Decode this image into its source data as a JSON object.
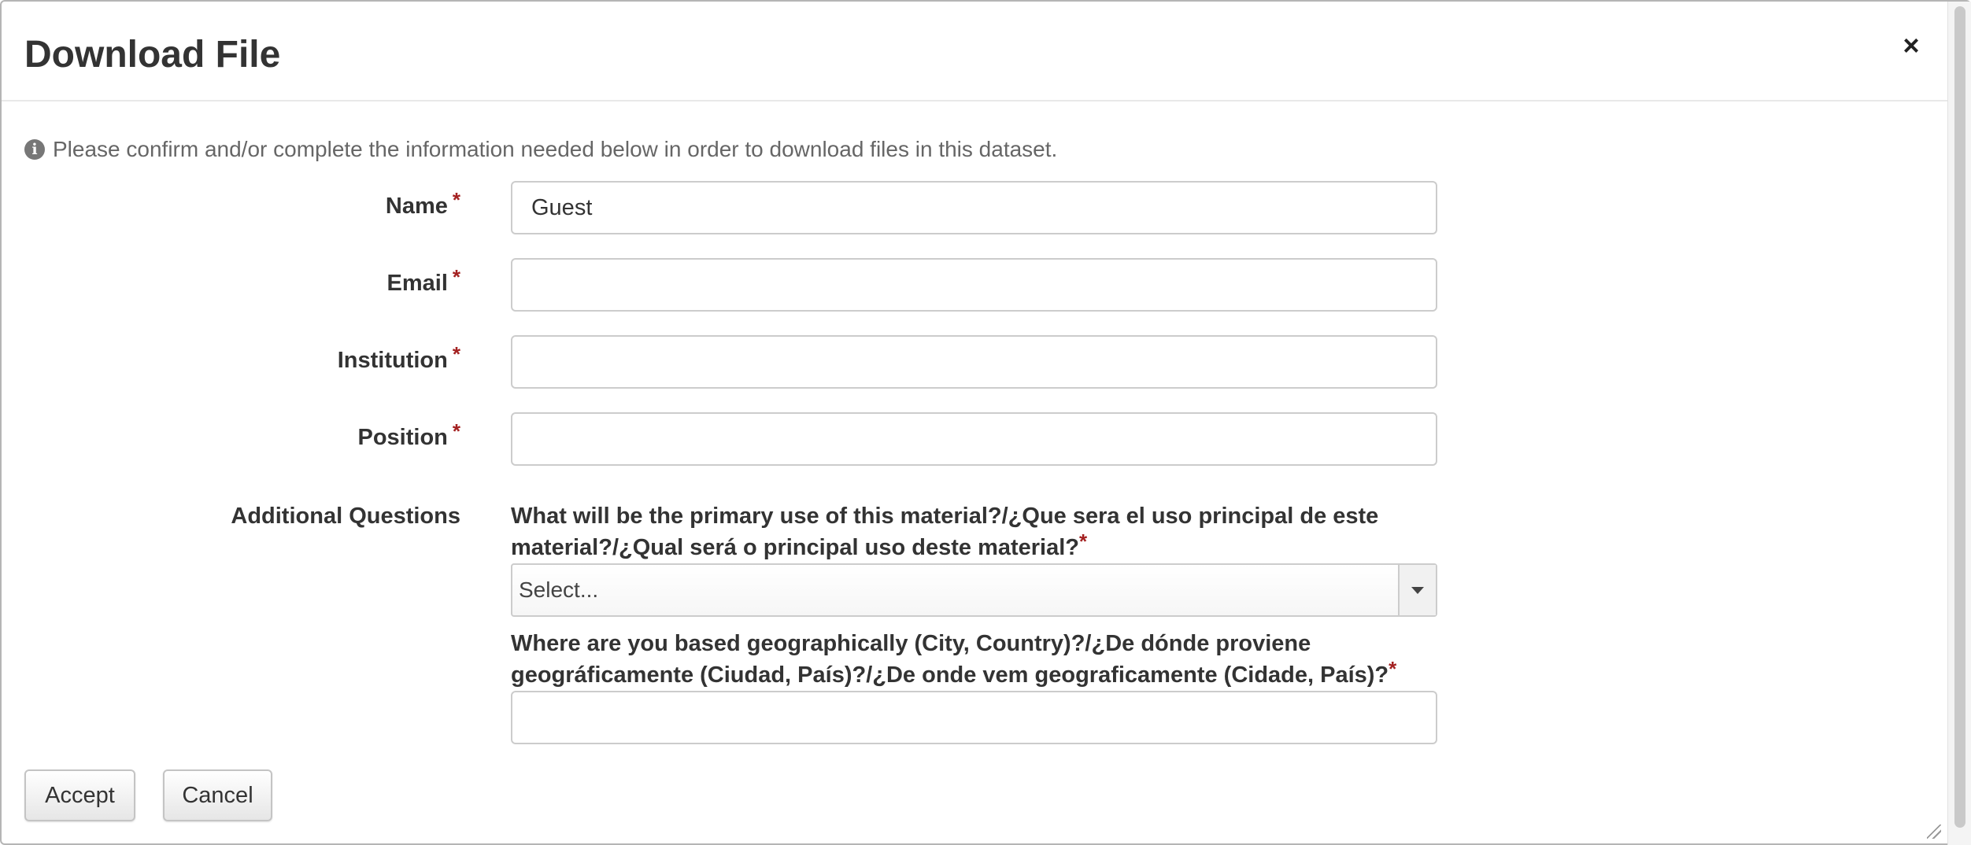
{
  "dialog": {
    "title": "Download File",
    "close_icon": "×"
  },
  "info": {
    "icon": "i",
    "text": "Please confirm and/or complete the information needed below in order to download files in this dataset."
  },
  "fields": {
    "required_mark": "*",
    "name": {
      "label": "Name",
      "value": "Guest"
    },
    "email": {
      "label": "Email",
      "value": ""
    },
    "institution": {
      "label": "Institution",
      "value": ""
    },
    "position": {
      "label": "Position",
      "value": ""
    }
  },
  "additional": {
    "label": "Additional Questions",
    "q1": {
      "text": "What will be the primary use of this material?/¿Que sera el uso principal de este material?/¿Qual será o principal uso deste material?",
      "select_value": "Select..."
    },
    "q2": {
      "text": "Where are you based geographically (City, Country)?/¿De dónde proviene geográficamente (Ciudad, País)?/¿De onde vem geograficamente (Cidade, País)?",
      "value": ""
    }
  },
  "buttons": {
    "accept": "Accept",
    "cancel": "Cancel"
  }
}
